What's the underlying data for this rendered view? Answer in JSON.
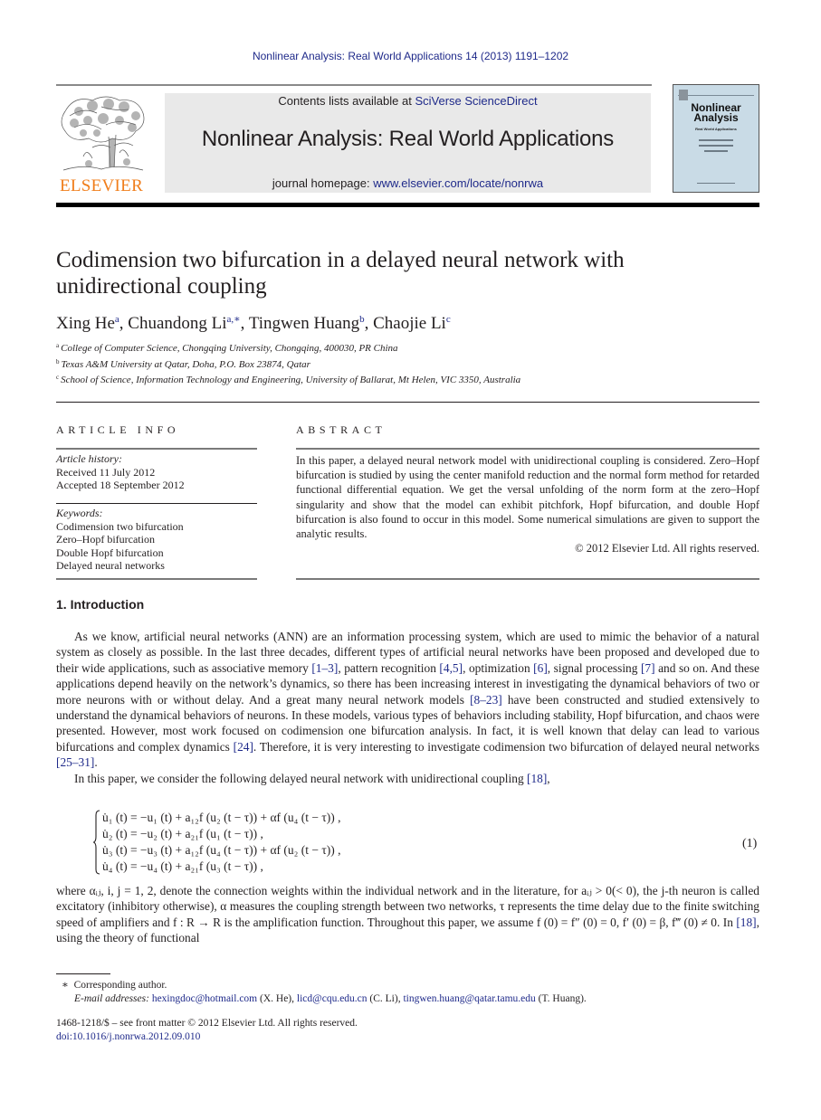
{
  "running_head": "Nonlinear Analysis: Real World Applications 14 (2013) 1191–1202",
  "masthead": {
    "publisher_logo_text": "ELSEVIER",
    "contents_prefix": "Contents lists available at ",
    "contents_link": "SciVerse ScienceDirect",
    "journal_title": "Nonlinear Analysis: Real World Applications",
    "homepage_prefix": "journal homepage: ",
    "homepage_link": "www.elsevier.com/locate/nonrwa",
    "cover_title_line1": "Nonlinear",
    "cover_title_line2": "Analysis",
    "cover_subtitle": "Real World Applications"
  },
  "article": {
    "title": "Codimension two bifurcation in a delayed neural network with unidirectional coupling",
    "authors": [
      {
        "name": "Xing He",
        "sup": "a",
        "sep": ", "
      },
      {
        "name": "Chuandong Li",
        "sup": "a,∗",
        "sep": ", "
      },
      {
        "name": "Tingwen Huang",
        "sup": "b",
        "sep": ", "
      },
      {
        "name": "Chaojie Li",
        "sup": "c",
        "sep": ""
      }
    ],
    "affiliations": [
      {
        "sup": "a",
        "text": "College of Computer Science, Chongqing University, Chongqing, 400030, PR China"
      },
      {
        "sup": "b",
        "text": "Texas A&M University at Qatar, Doha, P.O. Box 23874, Qatar"
      },
      {
        "sup": "c",
        "text": "School of Science, Information Technology and Engineering, University of Ballarat, Mt Helen, VIC 3350, Australia"
      }
    ]
  },
  "article_info": {
    "heading": "ARTICLE INFO",
    "history_label": "Article history:",
    "received": "Received 11 July 2012",
    "accepted": "Accepted 18 September 2012",
    "keywords_label": "Keywords:",
    "keywords": [
      "Codimension two bifurcation",
      "Zero–Hopf bifurcation",
      "Double Hopf bifurcation",
      "Delayed neural networks"
    ]
  },
  "abstract": {
    "heading": "ABSTRACT",
    "text": "In this paper, a delayed neural network model with unidirectional coupling is considered. Zero–Hopf bifurcation is studied by using the center manifold reduction and the normal form method for retarded functional differential equation. We get the versal unfolding of the norm form at the zero–Hopf singularity and show that the model can exhibit pitchfork, Hopf bifurcation, and double Hopf bifurcation is also found to occur in this model. Some numerical simulations are given to support the analytic results.",
    "copyright": "© 2012 Elsevier Ltd. All rights reserved."
  },
  "introduction": {
    "heading": "1. Introduction",
    "para1": [
      {
        "t": "As we know, artificial neural networks (ANN) are an information processing system, which are used to mimic the behavior of a natural system as closely as possible. In the last three decades, different types of artificial neural networks have been proposed and developed due to their wide applications, such as associative memory "
      },
      {
        "ref": "[1–3]"
      },
      {
        "t": ", pattern recognition "
      },
      {
        "ref": "[4,5]"
      },
      {
        "t": ", optimization "
      },
      {
        "ref": "[6]"
      },
      {
        "t": ", signal processing "
      },
      {
        "ref": "[7]"
      },
      {
        "t": " and so on. And these applications depend heavily on the network’s dynamics, so there has been increasing interest in investigating the dynamical behaviors of two or more neurons with or without delay. And a great many neural network models "
      },
      {
        "ref": "[8–23]"
      },
      {
        "t": " have been constructed and studied extensively to understand the dynamical behaviors of neurons. In these models, various types of behaviors including stability, Hopf bifurcation, and chaos were presented. However, most work focused on codimension one bifurcation analysis. In fact, it is well known that delay can lead to various bifurcations and complex dynamics "
      },
      {
        "ref": "[24]"
      },
      {
        "t": ". Therefore, it is very interesting to investigate codimension two bifurcation of delayed neural networks "
      },
      {
        "ref": "[25–31]"
      },
      {
        "t": "."
      }
    ],
    "para2_text": "In this paper, we consider the following delayed neural network with unidirectional coupling ",
    "para2_ref": "[18]",
    "para2_end": ",",
    "equation": [
      "u̇₁ (t) = −u₁ (t) + a₁₂f (u₂ (t − τ)) + αf (u₄ (t − τ)) ,",
      "u̇₂ (t) = −u₂ (t) + a₂₁f (u₁ (t − τ)) ,",
      "u̇₃ (t) = −u₃ (t) + a₁₂f (u₄ (t − τ)) + αf (u₂ (t − τ)) ,",
      "u̇₄ (t) = −u₄ (t) + a₂₁f (u₃ (t − τ)) ,"
    ],
    "equation_number": "(1)",
    "para3_text": "where αᵢⱼ, i, j = 1, 2, denote the connection weights within the individual network and in the literature, for aᵢⱼ > 0(< 0), the j-th neuron is called excitatory (inhibitory otherwise), α measures the coupling strength between two networks, τ represents the time delay due to the finite switching speed of amplifiers and f : R → R is the amplification function. Throughout this paper, we assume f (0) = f″ (0) = 0, f′ (0) = β, f‴ (0) ≠ 0. In ",
    "para3_ref": "[18]",
    "para3_end": ", using the theory of functional"
  },
  "footnotes": {
    "star": "∗",
    "corresponding": "Corresponding author.",
    "email_label": "E-mail addresses:",
    "emails": [
      {
        "addr": "hexingdoc@hotmail.com",
        "who": " (X. He), "
      },
      {
        "addr": "licd@cqu.edu.cn",
        "who": " (C. Li), "
      },
      {
        "addr": "tingwen.huang@qatar.tamu.edu",
        "who": " (T. Huang)."
      }
    ],
    "issn_line": "1468-1218/$ – see front matter © 2012 Elsevier Ltd. All rights reserved.",
    "doi": "doi:10.1016/j.nonrwa.2012.09.010"
  },
  "colors": {
    "link": "#1f2a8a",
    "elsevier_orange": "#f07d1a",
    "banner_bg": "#e9e9e9",
    "cover_bg": "#c9dbe6"
  }
}
